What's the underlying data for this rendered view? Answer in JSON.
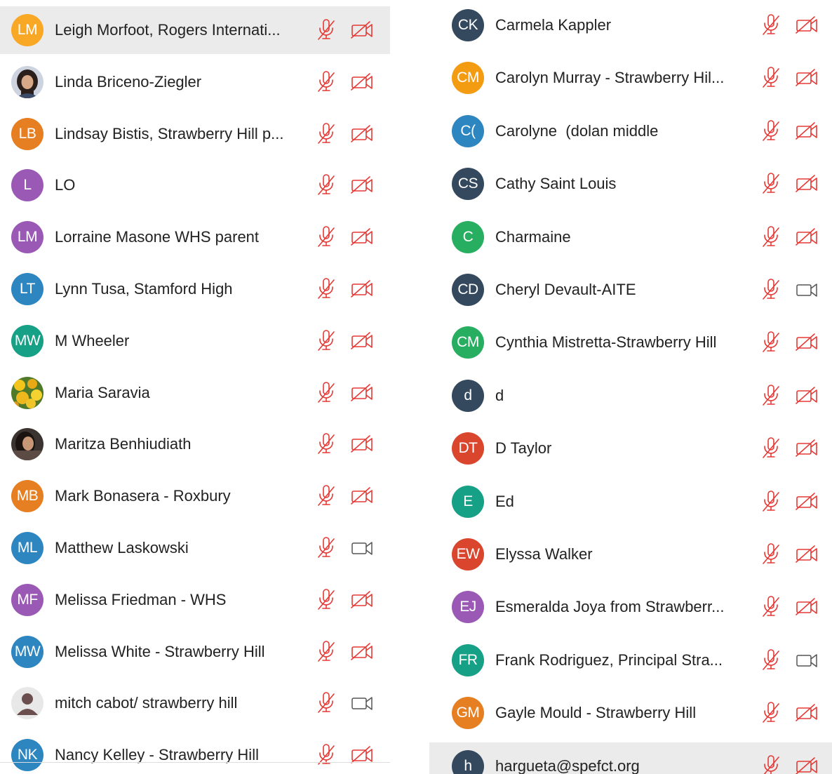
{
  "colors": {
    "muted": "#e53935",
    "camera_on": "#555555",
    "highlight_row": "#ebebeb"
  },
  "left_column": [
    {
      "initials": "LM",
      "name": "Leigh Morfoot, Rogers Internati...",
      "color": "#f9a825",
      "mic": "muted",
      "camera": "off",
      "highlighted": true
    },
    {
      "initials": "",
      "name": "Linda Briceno-Ziegler",
      "photo": "portrait-dark-hair",
      "mic": "muted",
      "camera": "off"
    },
    {
      "initials": "LB",
      "name": "Lindsay Bistis, Strawberry Hill p...",
      "color": "#e67e22",
      "mic": "muted",
      "camera": "off"
    },
    {
      "initials": "L",
      "name": "LO",
      "color": "#9b59b6",
      "mic": "muted",
      "camera": "off"
    },
    {
      "initials": "LM",
      "name": "Lorraine Masone WHS parent",
      "color": "#9b59b6",
      "mic": "muted",
      "camera": "off"
    },
    {
      "initials": "LT",
      "name": "Lynn Tusa, Stamford High",
      "color": "#2e86c1",
      "mic": "muted",
      "camera": "off"
    },
    {
      "initials": "MW",
      "name": "M Wheeler",
      "color": "#16a085",
      "mic": "muted",
      "camera": "off"
    },
    {
      "initials": "",
      "name": "Maria Saravia",
      "photo": "yellow-flowers",
      "mic": "muted",
      "camera": "off"
    },
    {
      "initials": "",
      "name": "Maritza Benhiudiath",
      "photo": "portrait-dark",
      "mic": "muted",
      "camera": "off"
    },
    {
      "initials": "MB",
      "name": "Mark Bonasera - Roxbury",
      "color": "#e67e22",
      "mic": "muted",
      "camera": "off"
    },
    {
      "initials": "ML",
      "name": "Matthew Laskowski",
      "color": "#2e86c1",
      "mic": "muted",
      "camera": "on"
    },
    {
      "initials": "MF",
      "name": "Melissa Friedman - WHS",
      "color": "#9b59b6",
      "mic": "muted",
      "camera": "off"
    },
    {
      "initials": "MW",
      "name": "Melissa White - Strawberry Hill",
      "color": "#2e86c1",
      "mic": "muted",
      "camera": "off"
    },
    {
      "initials": "",
      "name": "mitch cabot/ strawberry hill",
      "photo": "default-user",
      "mic": "muted",
      "camera": "on"
    },
    {
      "initials": "NK",
      "name": "Nancy Kelley - Strawberry Hill",
      "color": "#2e86c1",
      "mic": "muted",
      "camera": "off"
    }
  ],
  "right_column": [
    {
      "initials": "CK",
      "name": "Carmela Kappler",
      "color": "#34495e",
      "mic": "muted",
      "camera": "off"
    },
    {
      "initials": "CM",
      "name": "Carolyn Murray - Strawberry Hil...",
      "color": "#f39c12",
      "mic": "muted",
      "camera": "off"
    },
    {
      "initials": "C(",
      "name": "Carolyne  (dolan middle",
      "color": "#2e86c1",
      "mic": "muted",
      "camera": "off"
    },
    {
      "initials": "CS",
      "name": "Cathy Saint Louis",
      "color": "#34495e",
      "mic": "muted",
      "camera": "off"
    },
    {
      "initials": "C",
      "name": "Charmaine",
      "color": "#27ae60",
      "mic": "muted",
      "camera": "off"
    },
    {
      "initials": "CD",
      "name": "Cheryl Devault-AITE",
      "color": "#34495e",
      "mic": "muted",
      "camera": "on"
    },
    {
      "initials": "CM",
      "name": "Cynthia Mistretta-Strawberry Hill",
      "color": "#27ae60",
      "mic": "muted",
      "camera": "off"
    },
    {
      "initials": "d",
      "name": "d",
      "color": "#34495e",
      "mic": "muted",
      "camera": "off"
    },
    {
      "initials": "DT",
      "name": "D Taylor",
      "color": "#d9462d",
      "mic": "muted",
      "camera": "off"
    },
    {
      "initials": "E",
      "name": "Ed",
      "color": "#16a085",
      "mic": "muted",
      "camera": "off"
    },
    {
      "initials": "EW",
      "name": "Elyssa Walker",
      "color": "#d9462d",
      "mic": "muted",
      "camera": "off"
    },
    {
      "initials": "EJ",
      "name": "Esmeralda Joya from Strawberr...",
      "color": "#9b59b6",
      "mic": "muted",
      "camera": "off"
    },
    {
      "initials": "FR",
      "name": "Frank Rodriguez, Principal Stra...",
      "color": "#16a085",
      "mic": "muted",
      "camera": "on"
    },
    {
      "initials": "GM",
      "name": "Gayle Mould - Strawberry Hill",
      "color": "#e67e22",
      "mic": "muted",
      "camera": "off"
    },
    {
      "initials": "h",
      "name": "hargueta@spefct.org",
      "color": "#34495e",
      "mic": "muted",
      "camera": "off",
      "highlighted": true
    }
  ]
}
